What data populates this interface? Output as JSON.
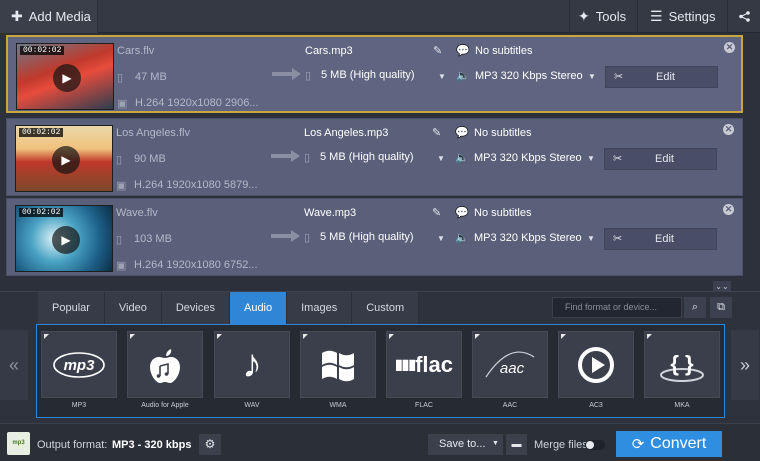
{
  "toolbar": {
    "add_media": "Add Media",
    "tools": "Tools",
    "settings": "Settings"
  },
  "files": [
    {
      "duration": "00:02:02",
      "source_name": "Cars.flv",
      "source_size": "47 MB",
      "codec": "H.264 1920x1080 2906...",
      "output_name": "Cars.mp3",
      "output_size": "5 MB (High quality)",
      "subtitles": "No subtitles",
      "audio": "MP3 320 Kbps Stereo",
      "edit": "Edit",
      "selected": true
    },
    {
      "duration": "00:02:02",
      "source_name": "Los Angeles.flv",
      "source_size": "90 MB",
      "codec": "H.264 1920x1080 5879...",
      "output_name": "Los Angeles.mp3",
      "output_size": "5 MB (High quality)",
      "subtitles": "No subtitles",
      "audio": "MP3 320 Kbps Stereo",
      "edit": "Edit",
      "selected": false
    },
    {
      "duration": "00:02:02",
      "source_name": "Wave.flv",
      "source_size": "103 MB",
      "codec": "H.264 1920x1080 6752...",
      "output_name": "Wave.mp3",
      "output_size": "5 MB (High quality)",
      "subtitles": "No subtitles",
      "audio": "MP3 320 Kbps Stereo",
      "edit": "Edit",
      "selected": false
    }
  ],
  "format_tabs": [
    "Popular",
    "Video",
    "Devices",
    "Audio",
    "Images",
    "Custom"
  ],
  "active_tab": "Audio",
  "search": {
    "placeholder": "Find format or device..."
  },
  "formats": [
    {
      "caption": "MP3",
      "icon": "mp3-logo-icon",
      "glyph": "mp3"
    },
    {
      "caption": "Audio for Apple",
      "icon": "apple-logo-icon",
      "glyph": ""
    },
    {
      "caption": "WAV",
      "icon": "music-note-icon",
      "glyph": "♪"
    },
    {
      "caption": "WMA",
      "icon": "windows-logo-icon",
      "glyph": ""
    },
    {
      "caption": "FLAC",
      "icon": "flac-logo-icon",
      "glyph": "flac"
    },
    {
      "caption": "AAC",
      "icon": "aac-logo-icon",
      "glyph": "aac"
    },
    {
      "caption": "AC3",
      "icon": "play-circle-icon",
      "glyph": ""
    },
    {
      "caption": "MKA",
      "icon": "braces-icon",
      "glyph": "{ }"
    }
  ],
  "nav": {
    "prev": "«",
    "next": "»"
  },
  "bottom": {
    "output_format_label": "Output format:",
    "output_format_value": "MP3 - 320 kbps",
    "format_badge": "mp3",
    "save_to": "Save to...",
    "merge_files": "Merge files",
    "convert": "Convert"
  },
  "colors": {
    "accent": "#2f86d6",
    "selected_border": "#c8a83e",
    "file_row": "#5a5f7a"
  }
}
